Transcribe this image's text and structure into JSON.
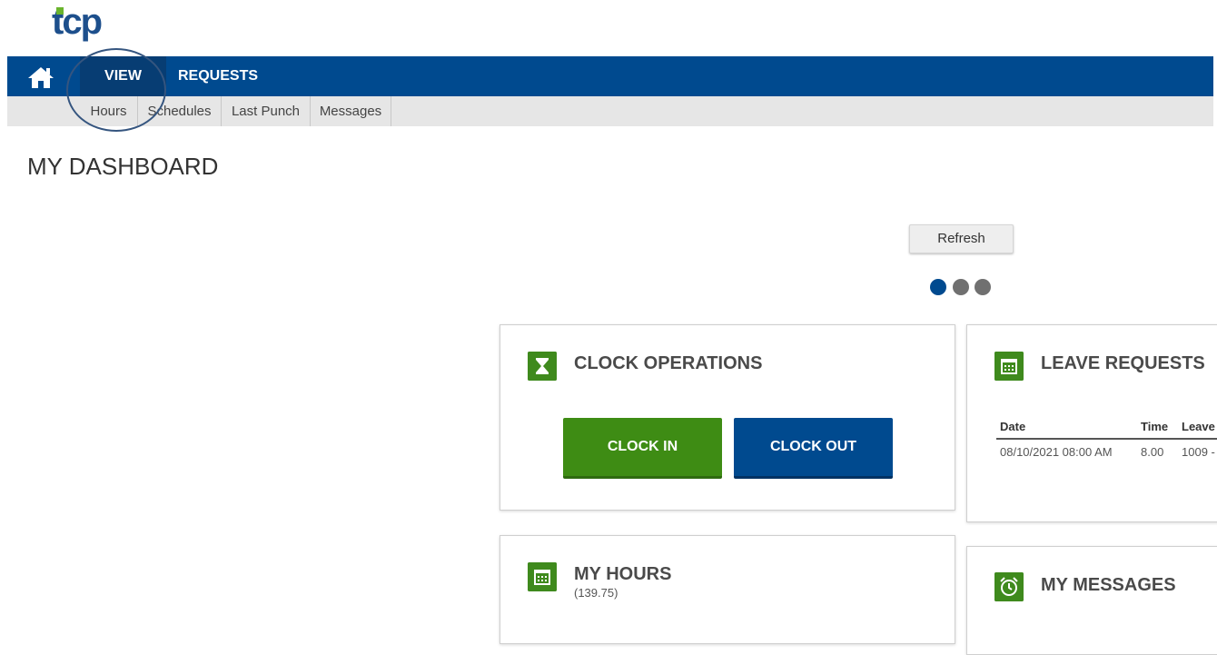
{
  "logo": {
    "text": "tcp"
  },
  "nav": {
    "view_label": "VIEW",
    "requests_label": "REQUESTS"
  },
  "subnav": [
    "Hours",
    "Schedules",
    "Last Punch",
    "Messages"
  ],
  "page": {
    "title": "MY DASHBOARD"
  },
  "refresh_label": "Refresh",
  "carousel": {
    "total": 3,
    "active": 1
  },
  "clock_ops": {
    "title": "CLOCK OPERATIONS",
    "clock_in_label": "CLOCK IN",
    "clock_out_label": "CLOCK OUT"
  },
  "leave_requests": {
    "title": "LEAVE REQUESTS",
    "columns": [
      "Date",
      "Time",
      "Leave"
    ],
    "rows": [
      {
        "date": "08/10/2021 08:00 AM",
        "time": "8.00",
        "leave": "1009 -"
      }
    ]
  },
  "my_hours": {
    "title": "MY HOURS",
    "total": "(139.75)"
  },
  "my_messages": {
    "title": "MY MESSAGES"
  },
  "colors": {
    "brand_blue": "#004a8f",
    "nav_active": "#073d73",
    "accent_green": "#3e8c14",
    "logo_green": "#6ab42d"
  },
  "icons": [
    "home-icon",
    "hourglass-icon",
    "calendar-icon",
    "alarm-clock-icon"
  ]
}
